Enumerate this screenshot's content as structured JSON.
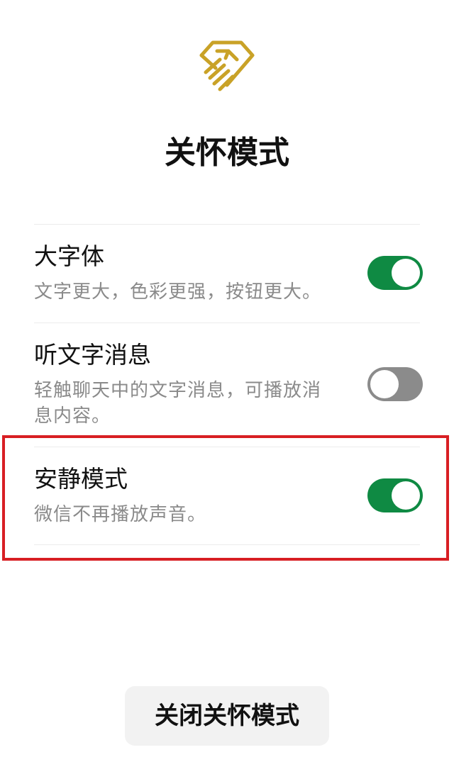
{
  "page": {
    "title": "关怀模式"
  },
  "settings": [
    {
      "title": "大字体",
      "description": "文字更大，色彩更强，按钮更大。",
      "enabled": true
    },
    {
      "title": "听文字消息",
      "description": "轻触聊天中的文字消息，可播放消息内容。",
      "enabled": false
    },
    {
      "title": "安静模式",
      "description": "微信不再播放声音。",
      "enabled": true
    }
  ],
  "footer": {
    "close_button_label": "关闭关怀模式"
  },
  "colors": {
    "accent_green": "#0f8a43",
    "toggle_off_gray": "#8b8b8b",
    "logo_gold": "#c9a227",
    "highlight_red": "#d81e23"
  },
  "icons": {
    "logo": "care-hand-heart-icon"
  }
}
